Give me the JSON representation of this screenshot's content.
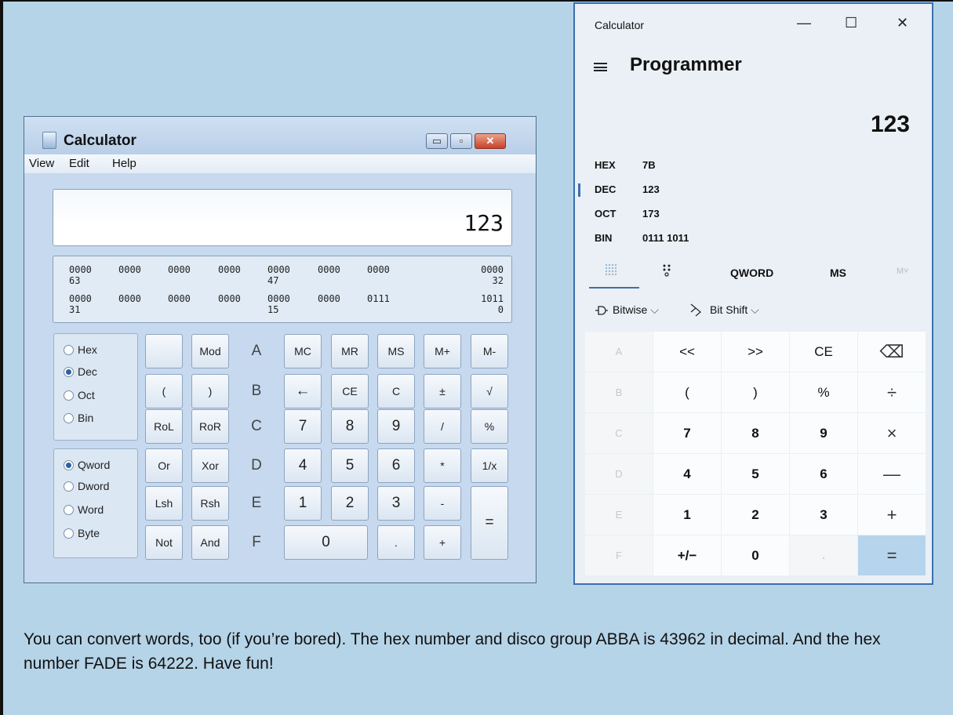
{
  "win7": {
    "title": "Calculator",
    "controls": {
      "minimize": "▭",
      "maximize": "▫",
      "close": "✕"
    },
    "menu": [
      "View",
      "Edit",
      "Help"
    ],
    "display_value": "123",
    "bit_rows": [
      {
        "groups": [
          "0000",
          "0000",
          "0000",
          "0000",
          "0000",
          "0000",
          "0000",
          "0000"
        ],
        "positions": [
          "63",
          "47",
          "32"
        ]
      },
      {
        "groups": [
          "0000",
          "0000",
          "0000",
          "0000",
          "0000",
          "0000",
          "0111",
          "1011"
        ],
        "positions": [
          "31",
          "15",
          "0"
        ]
      }
    ],
    "base_options": [
      {
        "label": "Hex",
        "selected": false
      },
      {
        "label": "Dec",
        "selected": true
      },
      {
        "label": "Oct",
        "selected": false
      },
      {
        "label": "Bin",
        "selected": false
      }
    ],
    "word_options": [
      {
        "label": "Qword",
        "selected": true
      },
      {
        "label": "Dword",
        "selected": false
      },
      {
        "label": "Word",
        "selected": false
      },
      {
        "label": "Byte",
        "selected": false
      }
    ],
    "keys": [
      [
        "",
        "Mod",
        "A",
        "MC",
        "MR",
        "MS",
        "M+",
        "M-"
      ],
      [
        "(",
        ")",
        "B",
        "←",
        "CE",
        "C",
        "±",
        "√"
      ],
      [
        "RoL",
        "RoR",
        "C",
        "7",
        "8",
        "9",
        "/",
        "%"
      ],
      [
        "Or",
        "Xor",
        "D",
        "4",
        "5",
        "6",
        "*",
        "1/x"
      ],
      [
        "Lsh",
        "Rsh",
        "E",
        "1",
        "2",
        "3",
        "-",
        "="
      ],
      [
        "Not",
        "And",
        "F",
        "0",
        ".",
        "+"
      ]
    ]
  },
  "win10": {
    "app_title": "Calculator",
    "controls": {
      "minimize": "—",
      "maximize": "☐",
      "close": "✕"
    },
    "mode": "Programmer",
    "display_value": "123",
    "radix": [
      {
        "label": "HEX",
        "value": "7B"
      },
      {
        "label": "DEC",
        "value": "123"
      },
      {
        "label": "OCT",
        "value": "173"
      },
      {
        "label": "BIN",
        "value": "0111 1011"
      }
    ],
    "word_size": "QWORD",
    "ms": "MS",
    "mv": "M˅",
    "bitwise": "Bitwise",
    "bitshift": "Bit Shift",
    "keys": [
      [
        "A",
        "<<",
        ">>",
        "CE",
        "⌫"
      ],
      [
        "B",
        "(",
        ")",
        "%",
        "÷"
      ],
      [
        "C",
        "7",
        "8",
        "9",
        "×"
      ],
      [
        "D",
        "4",
        "5",
        "6",
        "—"
      ],
      [
        "E",
        "1",
        "2",
        "3",
        "+"
      ],
      [
        "F",
        "+/−",
        "0",
        ".",
        "="
      ]
    ]
  },
  "caption": "You can convert words, too (if you’re bored). The hex number and disco group ABBA is 43962 in decimal. And the hex number FADE is 64222. Have fun!"
}
